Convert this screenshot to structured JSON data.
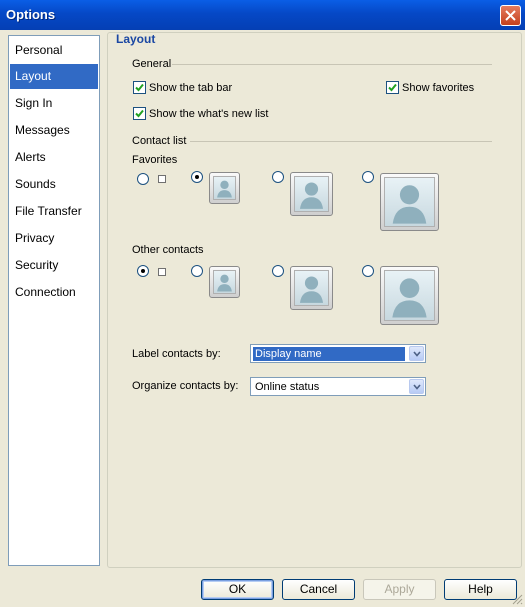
{
  "window": {
    "title": "Options"
  },
  "sidebar": {
    "items": [
      {
        "label": "Personal"
      },
      {
        "label": "Layout"
      },
      {
        "label": "Sign In"
      },
      {
        "label": "Messages"
      },
      {
        "label": "Alerts"
      },
      {
        "label": "Sounds"
      },
      {
        "label": "File Transfer"
      },
      {
        "label": "Privacy"
      },
      {
        "label": "Security"
      },
      {
        "label": "Connection"
      }
    ],
    "selected": "Layout"
  },
  "panel": {
    "heading": "Layout",
    "general": {
      "label": "General",
      "show_tab_bar": {
        "label": "Show the tab bar",
        "checked": true
      },
      "show_favorites": {
        "label": "Show favorites",
        "checked": true
      },
      "show_whats_new": {
        "label": "Show the what's new list",
        "checked": true
      }
    },
    "contact_list": {
      "label": "Contact list",
      "favorites_label": "Favorites",
      "favorites_selected_option": 2,
      "other_contacts_label": "Other contacts",
      "other_contacts_selected_option": 1
    },
    "label_contacts": {
      "label": "Label contacts by:",
      "value": "Display name"
    },
    "organize_contacts": {
      "label": "Organize contacts by:",
      "value": "Online status"
    }
  },
  "buttons": {
    "ok": "OK",
    "cancel": "Cancel",
    "apply": "Apply",
    "help": "Help"
  },
  "colors": {
    "titlebar": "#0548c6",
    "selection": "#316ac5",
    "heading": "#1a47a3"
  }
}
